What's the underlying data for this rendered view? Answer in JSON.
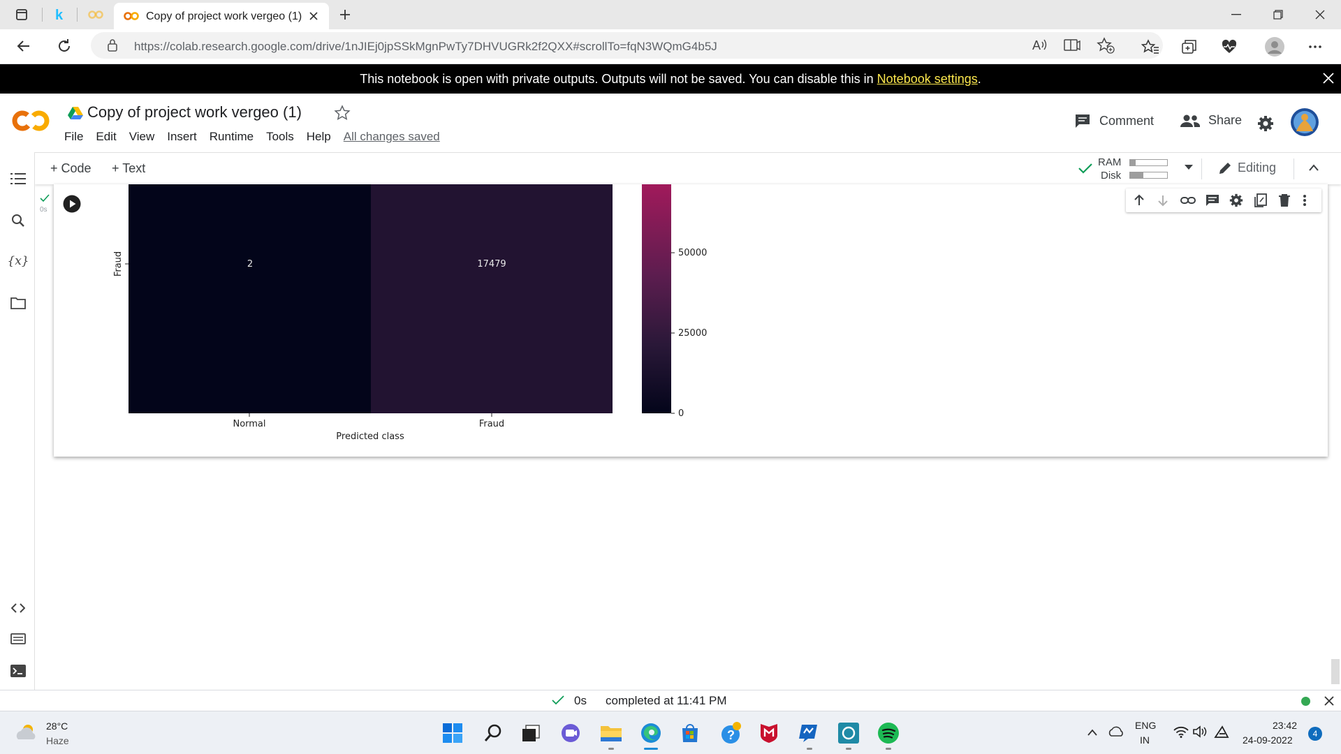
{
  "browser": {
    "tab_title": "Copy of project work vergeo (1)",
    "url": "https://colab.research.google.com/drive/1nJIEj0jpSSkMgnPwTy7DHVUGRk2f2QXX#scrollTo=fqN3WQmG4b5J"
  },
  "banner": {
    "text": "This notebook is open with private outputs. Outputs will not be saved. You can disable this in ",
    "link": "Notebook settings",
    "suffix": "."
  },
  "colab": {
    "title": "Copy of project work vergeo (1)",
    "menu": [
      "File",
      "Edit",
      "View",
      "Insert",
      "Runtime",
      "Tools",
      "Help"
    ],
    "saved_status": "All changes saved",
    "comment_label": "Comment",
    "share_label": "Share"
  },
  "toolbar": {
    "code_label": "Code",
    "text_label": "Text",
    "ram_label": "RAM",
    "disk_label": "Disk",
    "editing_label": "Editing"
  },
  "cell": {
    "exec_time": "0s"
  },
  "chart_data": {
    "type": "heatmap",
    "x_tick_labels": [
      "Normal",
      "Fraud"
    ],
    "y_tick_labels": [
      "Fraud"
    ],
    "xlabel": "Predicted class",
    "ylabel": "",
    "visible_row": {
      "name": "Fraud",
      "values": [
        2,
        17479
      ]
    },
    "colorbar": {
      "ticks": [
        0,
        25000,
        50000
      ],
      "colormap": "rocket"
    },
    "colors": {
      "low": "#03051a",
      "mid": "#221331",
      "high": "#a11a5b"
    }
  },
  "statusbar": {
    "time": "0s",
    "completed": "completed at 11:41 PM"
  },
  "taskbar": {
    "weather_temp": "28°C",
    "weather_desc": "Haze",
    "lang_top": "ENG",
    "lang_bottom": "IN",
    "clock_time": "23:42",
    "clock_date": "24-09-2022",
    "notif_count": "4"
  }
}
